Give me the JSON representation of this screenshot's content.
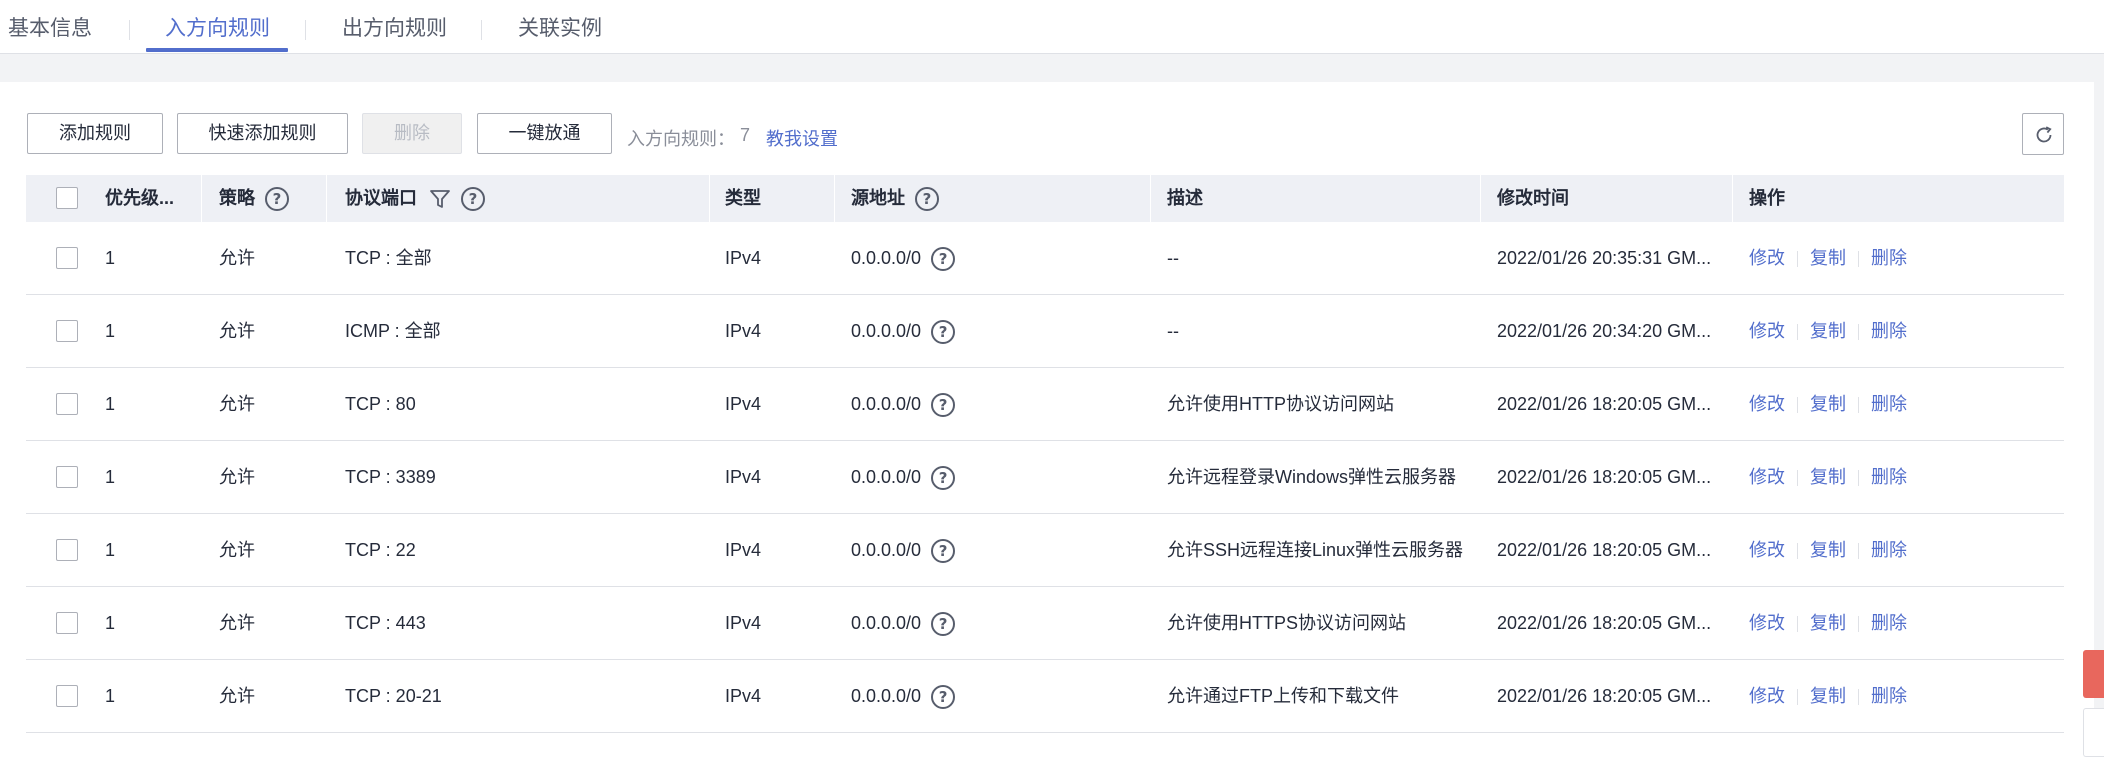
{
  "tabs": [
    {
      "label": "基本信息",
      "active": false
    },
    {
      "label": "入方向规则",
      "active": true
    },
    {
      "label": "出方向规则",
      "active": false
    },
    {
      "label": "关联实例",
      "active": false
    }
  ],
  "toolbar": {
    "add_rule": "添加规则",
    "quick_add_rule": "快速添加规则",
    "delete": "删除",
    "one_click_allow": "一键放通",
    "rule_count_label": "入方向规则：",
    "rule_count": "7",
    "teach_link": "教我设置"
  },
  "table": {
    "columns": [
      "优先级...",
      "策略",
      "协议端口",
      "类型",
      "源地址",
      "描述",
      "修改时间",
      "操作"
    ],
    "actions": [
      "修改",
      "复制",
      "删除"
    ],
    "rows": [
      {
        "priority": "1",
        "policy": "允许",
        "protocol_port": "TCP : 全部",
        "type": "IPv4",
        "source": "0.0.0.0/0",
        "description": "--",
        "modified": "2022/01/26 20:35:31 GM..."
      },
      {
        "priority": "1",
        "policy": "允许",
        "protocol_port": "ICMP : 全部",
        "type": "IPv4",
        "source": "0.0.0.0/0",
        "description": "--",
        "modified": "2022/01/26 20:34:20 GM..."
      },
      {
        "priority": "1",
        "policy": "允许",
        "protocol_port": "TCP : 80",
        "type": "IPv4",
        "source": "0.0.0.0/0",
        "description": "允许使用HTTP协议访问网站",
        "modified": "2022/01/26 18:20:05 GM..."
      },
      {
        "priority": "1",
        "policy": "允许",
        "protocol_port": "TCP : 3389",
        "type": "IPv4",
        "source": "0.0.0.0/0",
        "description": "允许远程登录Windows弹性云服务器",
        "modified": "2022/01/26 18:20:05 GM..."
      },
      {
        "priority": "1",
        "policy": "允许",
        "protocol_port": "TCP : 22",
        "type": "IPv4",
        "source": "0.0.0.0/0",
        "description": "允许SSH远程连接Linux弹性云服务器",
        "modified": "2022/01/26 18:20:05 GM..."
      },
      {
        "priority": "1",
        "policy": "允许",
        "protocol_port": "TCP : 443",
        "type": "IPv4",
        "source": "0.0.0.0/0",
        "description": "允许使用HTTPS协议访问网站",
        "modified": "2022/01/26 18:20:05 GM..."
      },
      {
        "priority": "1",
        "policy": "允许",
        "protocol_port": "TCP : 20-21",
        "type": "IPv4",
        "source": "0.0.0.0/0",
        "description": "允许通过FTP上传和下载文件",
        "modified": "2022/01/26 18:20:05 GM..."
      }
    ]
  },
  "colors": {
    "accent": "#526ecc",
    "header_bg": "#eef0f5",
    "float_red": "#e8675d"
  },
  "icons": {
    "help": "question-circle-icon",
    "filter": "filter-icon",
    "refresh": "refresh-icon"
  }
}
